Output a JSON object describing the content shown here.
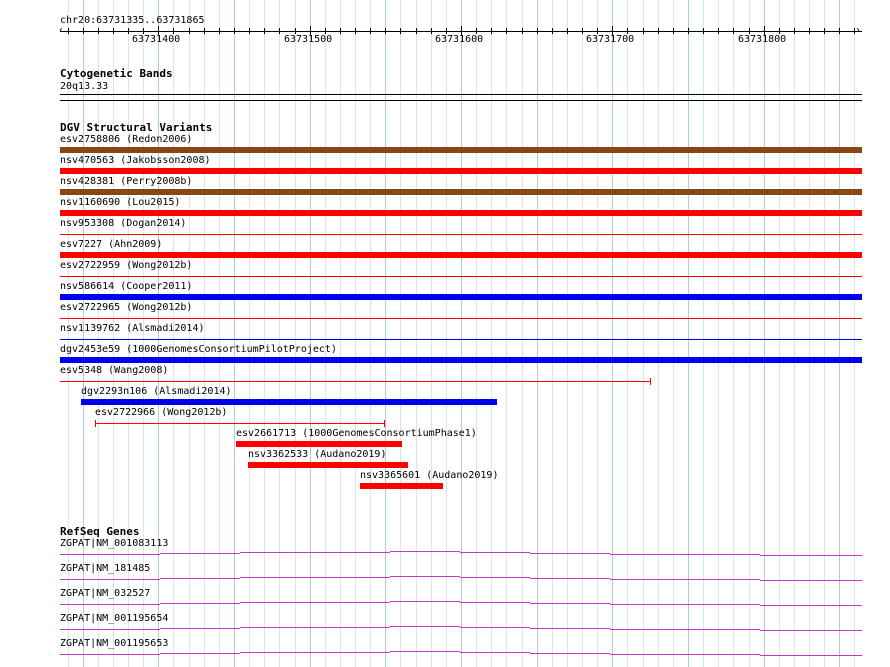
{
  "ruler": {
    "region": "chr20:63731335..63731865",
    "start": 63731335,
    "end": 63731865,
    "major_ticks": [
      "63731400",
      "63731500",
      "63731600",
      "63731700",
      "63731800"
    ]
  },
  "tracks": {
    "cytobands": {
      "title": "Cytogenetic Bands",
      "band": "20q13.33"
    },
    "dgv": {
      "title": "DGV Structural Variants",
      "colors": {
        "brown": "#8b4513",
        "red": "#ff0000",
        "blue": "#0000ee"
      },
      "features": [
        {
          "label": "esv2758806 (Redon2006)",
          "start": 63731335,
          "end": 63731865,
          "color": "#8b4513",
          "style": "thick"
        },
        {
          "label": "nsv470563 (Jakobsson2008)",
          "start": 63731335,
          "end": 63731865,
          "color": "#ff0000",
          "style": "thick"
        },
        {
          "label": "nsv428381 (Perry2008b)",
          "start": 63731335,
          "end": 63731865,
          "color": "#8b4513",
          "style": "thick"
        },
        {
          "label": "nsv1160690 (Lou2015)",
          "start": 63731335,
          "end": 63731865,
          "color": "#ff0000",
          "style": "thick"
        },
        {
          "label": "nsv953308 (Dogan2014)",
          "start": 63731335,
          "end": 63731865,
          "color": "#ff0000",
          "style": "thin"
        },
        {
          "label": "esv7227 (Ahn2009)",
          "start": 63731335,
          "end": 63731865,
          "color": "#ff0000",
          "style": "thick"
        },
        {
          "label": "esv2722959 (Wong2012b)",
          "start": 63731335,
          "end": 63731865,
          "color": "#ff0000",
          "style": "thin"
        },
        {
          "label": "nsv586614 (Cooper2011)",
          "start": 63731335,
          "end": 63731865,
          "color": "#0000ee",
          "style": "thick"
        },
        {
          "label": "esv2722965 (Wong2012b)",
          "start": 63731335,
          "end": 63731865,
          "color": "#ff0000",
          "style": "thin"
        },
        {
          "label": "nsv1139762 (Alsmadi2014)",
          "start": 63731335,
          "end": 63731865,
          "color": "#0000ee",
          "style": "thin"
        },
        {
          "label": "dgv2453e59 (1000GenomesConsortiumPilotProject)",
          "start": 63731335,
          "end": 63731865,
          "color": "#0000ee",
          "style": "thick"
        },
        {
          "label": "esv5348 (Wang2008)",
          "start": 63731335,
          "end": 63731725,
          "color": "#ff0000",
          "style": "whisker-end"
        },
        {
          "label": "dgv2293n106 (Alsmadi2014)",
          "start": 63731349,
          "end": 63731624,
          "color": "#0000ee",
          "style": "thick"
        },
        {
          "label": "esv2722966 (Wong2012b)",
          "start": 63731358,
          "end": 63731549,
          "color": "#ff0000",
          "style": "whisker-both"
        },
        {
          "label": "esv2661713 (1000GenomesConsortiumPhase1)",
          "start": 63731451,
          "end": 63731561,
          "color": "#ff0000",
          "style": "thick"
        },
        {
          "label": "nsv3362533 (Audano2019)",
          "start": 63731459,
          "end": 63731565,
          "color": "#ff0000",
          "style": "thick"
        },
        {
          "label": "nsv3365601 (Audano2019)",
          "start": 63731533,
          "end": 63731588,
          "color": "#ff0000",
          "style": "thick"
        }
      ]
    },
    "refseq": {
      "title": "RefSeq Genes",
      "color": "#cc33cc",
      "genes": [
        {
          "label": "ZGPAT|NM_001083113"
        },
        {
          "label": "ZGPAT|NM_181485"
        },
        {
          "label": "ZGPAT|NM_032527"
        },
        {
          "label": "ZGPAT|NM_001195654"
        },
        {
          "label": "ZGPAT|NM_001195653"
        }
      ]
    }
  }
}
